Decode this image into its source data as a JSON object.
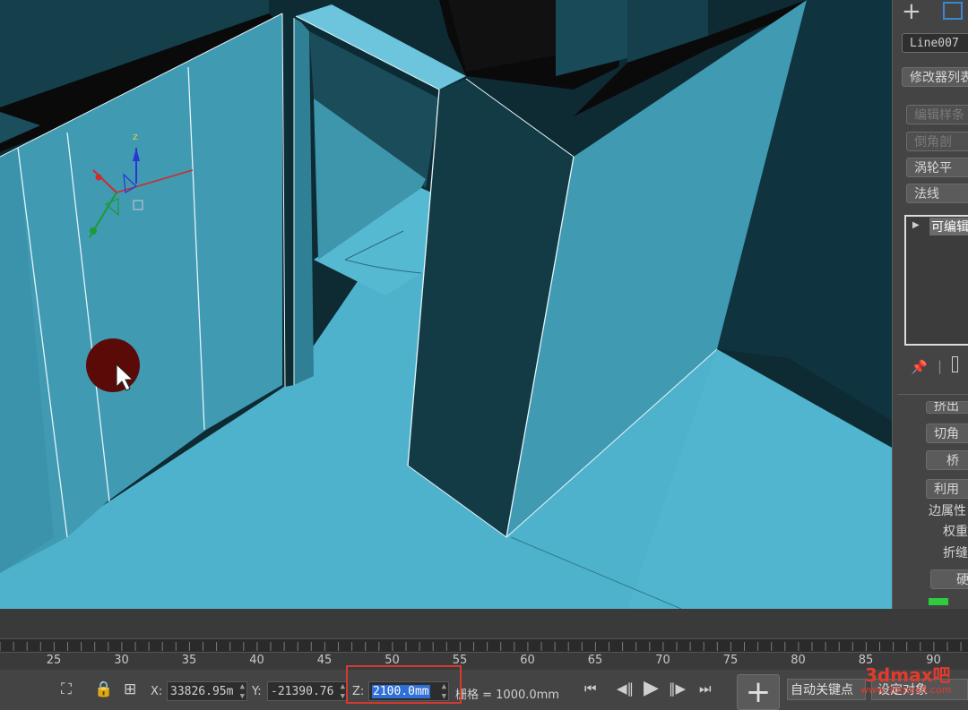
{
  "viewport": {
    "axis_z": "z",
    "object_name": "Line007"
  },
  "right_panel": {
    "modifier_list": "修改器列表",
    "stack_buttons": [
      "编辑样条",
      "倒角剖",
      "涡轮平",
      "法线"
    ],
    "stack_item": "可编辑",
    "rollout_buttons": [
      "挤出",
      "切角",
      "桥",
      "利用"
    ],
    "edge_props_label": "边属性",
    "weight_label": "权重",
    "crease_label": "折缝",
    "apply_button": "硬"
  },
  "timeline": {
    "ticks": [
      "25",
      "30",
      "35",
      "40",
      "45",
      "50",
      "55",
      "60",
      "65",
      "70",
      "75",
      "80",
      "85",
      "90"
    ]
  },
  "status": {
    "x_label": "X:",
    "x_value": "33826.95m",
    "y_label": "Y:",
    "y_value": "-21390.76",
    "z_label": "Z:",
    "z_value": "2100.0mm",
    "grid_label": "栅格 = 1000.0mm",
    "auto_key": "自动关键点",
    "set_key": "设定对象",
    "watermark_brand": "3dmax吧",
    "watermark_url": "www.3dmax8.com"
  },
  "colors": {
    "floor": "#4fb2cc",
    "wall_light": "#3e98b0",
    "wall_dark": "#123d48",
    "highlight": "#d63a2f"
  }
}
